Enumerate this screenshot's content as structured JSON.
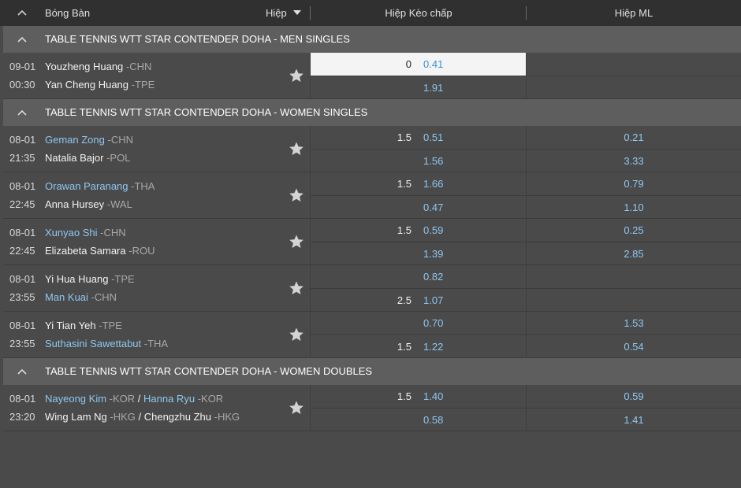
{
  "header": {
    "sport": "Bóng Bàn",
    "period": "Hiệp",
    "col_handicap": "Hiệp Kèo chấp",
    "col_ml": "Hiệp ML"
  },
  "leagues": [
    {
      "name": "TABLE TENNIS WTT STAR CONTENDER DOHA - MEN SINGLES",
      "matches": [
        {
          "date": "09-01",
          "time": "00:30",
          "home": [
            {
              "name": "Youzheng Huang",
              "country": "-CHN"
            }
          ],
          "away": [
            {
              "name": "Yan Cheng Huang",
              "country": "-TPE"
            }
          ],
          "hc1": {
            "line": "0",
            "odds": "0.41"
          },
          "hc2": {
            "line": "",
            "odds": "1.91"
          },
          "ml1": "",
          "ml2": ""
        }
      ]
    },
    {
      "name": "TABLE TENNIS WTT STAR CONTENDER DOHA - WOMEN SINGLES",
      "matches": [
        {
          "date": "08-01",
          "time": "21:35",
          "home": [
            {
              "name": "Geman Zong",
              "country": "-CHN"
            }
          ],
          "away": [
            {
              "name": "Natalia Bajor",
              "country": "-POL"
            }
          ],
          "hc1": {
            "line": "1.5",
            "odds": "0.51"
          },
          "hc2": {
            "line": "",
            "odds": "1.56"
          },
          "ml1": "0.21",
          "ml2": "3.33"
        },
        {
          "date": "08-01",
          "time": "22:45",
          "home": [
            {
              "name": "Orawan Paranang",
              "country": "-THA"
            }
          ],
          "away": [
            {
              "name": "Anna Hursey",
              "country": "-WAL"
            }
          ],
          "hc1": {
            "line": "1.5",
            "odds": "1.66"
          },
          "hc2": {
            "line": "",
            "odds": "0.47"
          },
          "ml1": "0.79",
          "ml2": "1.10"
        },
        {
          "date": "08-01",
          "time": "22:45",
          "home": [
            {
              "name": "Xunyao Shi",
              "country": "-CHN"
            }
          ],
          "away": [
            {
              "name": "Elizabeta Samara",
              "country": "-ROU"
            }
          ],
          "hc1": {
            "line": "1.5",
            "odds": "0.59"
          },
          "hc2": {
            "line": "",
            "odds": "1.39"
          },
          "ml1": "0.25",
          "ml2": "2.85"
        },
        {
          "date": "08-01",
          "time": "23:55",
          "home": [
            {
              "name": "Yi Hua Huang",
              "country": "-TPE"
            }
          ],
          "away": [
            {
              "name": "Man Kuai",
              "country": "-CHN"
            }
          ],
          "hc1": {
            "line": "",
            "odds": "0.82"
          },
          "hc2": {
            "line": "2.5",
            "odds": "1.07"
          },
          "ml1": "",
          "ml2": ""
        },
        {
          "date": "08-01",
          "time": "23:55",
          "home": [
            {
              "name": "Yi Tian Yeh",
              "country": "-TPE"
            }
          ],
          "away": [
            {
              "name": "Suthasini Sawettabut",
              "country": "-THA"
            }
          ],
          "hc1": {
            "line": "",
            "odds": "0.70"
          },
          "hc2": {
            "line": "1.5",
            "odds": "1.22"
          },
          "ml1": "1.53",
          "ml2": "0.54"
        }
      ]
    },
    {
      "name": "TABLE TENNIS WTT STAR CONTENDER DOHA - WOMEN DOUBLES",
      "matches": [
        {
          "date": "08-01",
          "time": "23:20",
          "home": [
            {
              "name": "Nayeong Kim",
              "country": "-KOR"
            },
            {
              "name": "Hanna Ryu",
              "country": "-KOR"
            }
          ],
          "away": [
            {
              "name": "Wing Lam Ng",
              "country": "-HKG"
            },
            {
              "name": "Chengzhu Zhu",
              "country": "-HKG"
            }
          ],
          "hc1": {
            "line": "1.5",
            "odds": "1.40"
          },
          "hc2": {
            "line": "",
            "odds": "0.58"
          },
          "ml1": "0.59",
          "ml2": "1.41"
        }
      ]
    }
  ],
  "colors": {
    "highlight_team": "#8ec7f0",
    "odds": "#8ec7f0",
    "selected_cell": "#f4f4f4"
  }
}
